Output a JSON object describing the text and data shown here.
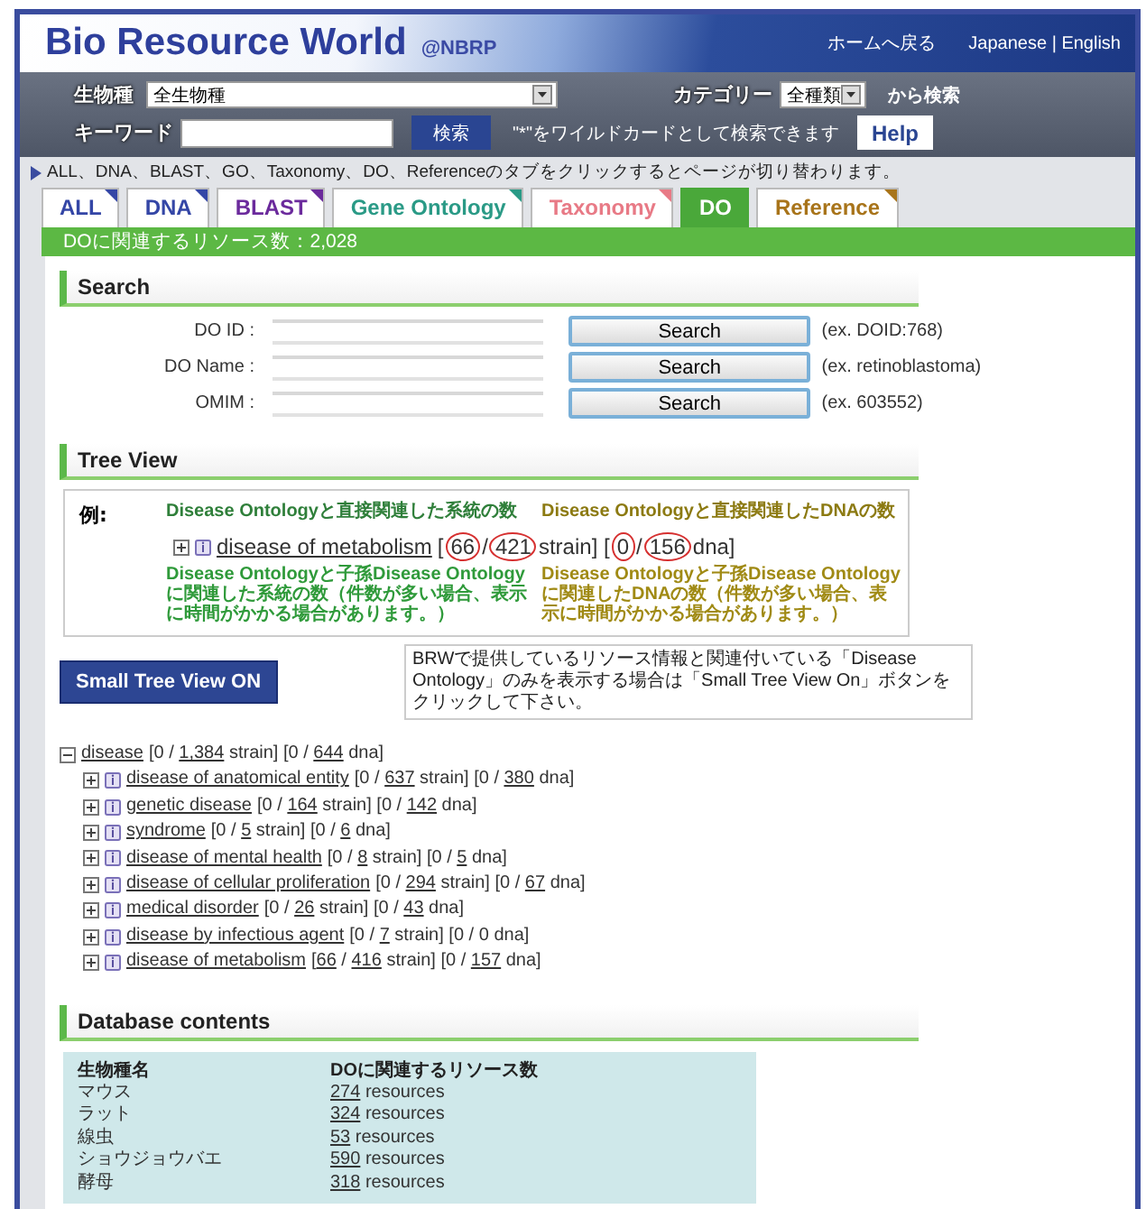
{
  "header": {
    "title": "Bio Resource World",
    "subtitle": "@NBRP",
    "links": [
      "ホームへ戻る",
      "Japanese | English"
    ]
  },
  "searchbar": {
    "species_label": "生物種",
    "species_value": "全生物種",
    "category_label": "カテゴリー",
    "category_value": "全種類",
    "category_suffix": "から検索",
    "keyword_label": "キーワード",
    "search_button": "検索",
    "wildcard_note": "\"*\"をワイルドカードとして検索できます",
    "help_button": "Help"
  },
  "notice": "ALL、DNA、BLAST、GO、Taxonomy、DO、Referenceのタブをクリックするとページが切り替わります。",
  "tabs": [
    {
      "label": "ALL",
      "color": "#3446a6",
      "selected": false
    },
    {
      "label": "DNA",
      "color": "#3446a6",
      "selected": false
    },
    {
      "label": "BLAST",
      "color": "#6b2a9c",
      "selected": false
    },
    {
      "label": "Gene Ontology",
      "color": "#2a9a86",
      "selected": false
    },
    {
      "label": "Taxonomy",
      "color": "#e87a86",
      "selected": false
    },
    {
      "label": "DO",
      "color": "#4aa83a",
      "selected": true
    },
    {
      "label": "Reference",
      "color": "#a8741a",
      "selected": false
    }
  ],
  "count_bar": "DOに関連するリソース数：2,028",
  "search_section": {
    "title": "Search",
    "rows": [
      {
        "label": "DO ID :",
        "button": "Search",
        "example": "(ex. DOID:768)"
      },
      {
        "label": "DO Name :",
        "button": "Search",
        "example": "(ex. retinoblastoma)"
      },
      {
        "label": "OMIM :",
        "button": "Search",
        "example": "(ex. 603552)"
      }
    ]
  },
  "tree_view": {
    "title": "Tree View",
    "example": {
      "label": "例:",
      "top_notes": [
        {
          "text": "Disease Ontologyと直接関連した系統の数",
          "color": "#2f7f3a"
        },
        {
          "text": "Disease Ontologyと直接関連したDNAの数",
          "color": "#8c7a12"
        }
      ],
      "item": {
        "name": "disease of metabolism",
        "counts": [
          {
            "text": "["
          },
          {
            "text": "66",
            "circled": true
          },
          {
            "text": "/"
          },
          {
            "text": "421",
            "circled": true
          },
          {
            "text": "strain] ["
          },
          {
            "text": "0",
            "circled": true
          },
          {
            "text": "/"
          },
          {
            "text": "156",
            "circled": true
          },
          {
            "text": "dna]"
          }
        ]
      },
      "bottom_notes": [
        {
          "text": "Disease Ontologyと子孫Disease Ontology に関連した系統の数（件数が多い場合、表示に時間がかかる場合があります。）",
          "color": "#2f9a3a"
        },
        {
          "text": "Disease Ontologyと子孫Disease Ontology に関連したDNAの数（件数が多い場合、表示に時間がかかる場合があります。）",
          "color": "#a08a14"
        }
      ]
    },
    "button": "Small Tree View ON",
    "button_note": "BRWで提供しているリソース情報と関連付いている「Disease Ontology」のみを表示する場合は「Small Tree View On」ボタンをクリックして下さい。",
    "tree": {
      "name": "disease",
      "expanded": true,
      "counts": [
        {
          "text": "[0 / "
        },
        {
          "text": "1,384",
          "link": true
        },
        {
          "text": " strain] [0 / "
        },
        {
          "text": "644",
          "link": true
        },
        {
          "text": " dna]"
        }
      ],
      "children": [
        {
          "name": "disease of anatomical entity",
          "expanded": false,
          "counts": [
            {
              "text": "[0 / "
            },
            {
              "text": "637",
              "link": true
            },
            {
              "text": " strain] [0 / "
            },
            {
              "text": "380",
              "link": true
            },
            {
              "text": " dna]"
            }
          ]
        },
        {
          "name": "genetic disease",
          "expanded": false,
          "counts": [
            {
              "text": "[0 / "
            },
            {
              "text": "164",
              "link": true
            },
            {
              "text": " strain] [0 / "
            },
            {
              "text": "142",
              "link": true
            },
            {
              "text": " dna]"
            }
          ]
        },
        {
          "name": "syndrome",
          "expanded": false,
          "counts": [
            {
              "text": "[0 / "
            },
            {
              "text": "5",
              "link": true
            },
            {
              "text": " strain] [0 / "
            },
            {
              "text": "6",
              "link": true
            },
            {
              "text": " dna]"
            }
          ]
        },
        {
          "name": "disease of mental health",
          "expanded": false,
          "counts": [
            {
              "text": "[0 / "
            },
            {
              "text": "8",
              "link": true
            },
            {
              "text": " strain] [0 / "
            },
            {
              "text": "5",
              "link": true
            },
            {
              "text": " dna]"
            }
          ]
        },
        {
          "name": "disease of cellular proliferation",
          "expanded": false,
          "counts": [
            {
              "text": "[0 / "
            },
            {
              "text": "294",
              "link": true
            },
            {
              "text": " strain] [0 / "
            },
            {
              "text": "67",
              "link": true
            },
            {
              "text": " dna]"
            }
          ]
        },
        {
          "name": "medical disorder",
          "expanded": false,
          "counts": [
            {
              "text": "[0 / "
            },
            {
              "text": "26",
              "link": true
            },
            {
              "text": " strain] [0 / "
            },
            {
              "text": "43",
              "link": true
            },
            {
              "text": " dna]"
            }
          ]
        },
        {
          "name": "disease by infectious agent",
          "expanded": false,
          "counts": [
            {
              "text": "[0 / "
            },
            {
              "text": "7",
              "link": true
            },
            {
              "text": " strain] [0 / 0 dna]"
            }
          ]
        },
        {
          "name": "disease of metabolism",
          "expanded": false,
          "counts": [
            {
              "text": "["
            },
            {
              "text": "66",
              "link": true
            },
            {
              "text": " / "
            },
            {
              "text": "416",
              "link": true
            },
            {
              "text": " strain] [0 / "
            },
            {
              "text": "157",
              "link": true
            },
            {
              "text": " dna]"
            }
          ]
        }
      ]
    }
  },
  "database": {
    "title": "Database contents",
    "columns": [
      "生物種名",
      "DOに関連するリソース数"
    ],
    "rows": [
      {
        "species": "マウス",
        "count": "274",
        "unit": "resources"
      },
      {
        "species": "ラット",
        "count": "324",
        "unit": "resources"
      },
      {
        "species": "線虫",
        "count": "53",
        "unit": "resources"
      },
      {
        "species": "ショウジョウバエ",
        "count": "590",
        "unit": "resources"
      },
      {
        "species": "酵母",
        "count": "318",
        "unit": "resources"
      }
    ]
  }
}
